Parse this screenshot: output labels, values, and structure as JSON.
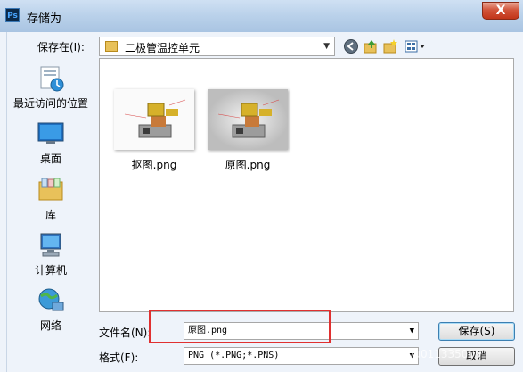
{
  "window": {
    "title": "存储为",
    "app_icon_text": "Ps",
    "close_label": "X"
  },
  "toolbar": {
    "save_in_label": "保存在(I):",
    "current_folder": "二极管温控单元",
    "icons": [
      "back-icon",
      "up-folder-icon",
      "new-folder-icon",
      "view-menu-icon"
    ]
  },
  "places": [
    {
      "label": "最近访问的位置",
      "icon": "recent-places-icon"
    },
    {
      "label": "桌面",
      "icon": "desktop-icon"
    },
    {
      "label": "库",
      "icon": "library-icon"
    },
    {
      "label": "计算机",
      "icon": "computer-icon"
    },
    {
      "label": "网络",
      "icon": "network-icon"
    }
  ],
  "files": [
    {
      "name": "抠图.png"
    },
    {
      "name": "原图.png"
    }
  ],
  "form": {
    "filename_label": "文件名(N):",
    "filename_value": "原图.png",
    "format_label": "格式(F):",
    "format_value": "PNG (*.PNG;*.PNS)"
  },
  "buttons": {
    "save": "保存(S)",
    "cancel": "取消"
  },
  "watermark": "https://blog.csdn.net/u011335009",
  "colors": {
    "highlight": "#e03030",
    "titlebar": "#b9d1ea",
    "body": "#eef3fa"
  }
}
